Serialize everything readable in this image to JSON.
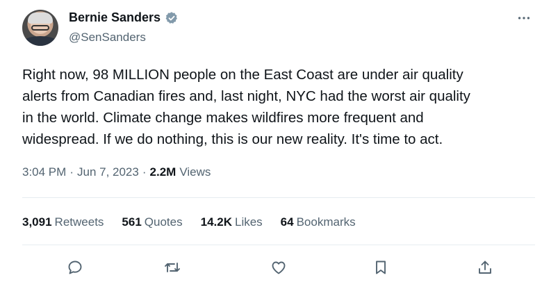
{
  "author": {
    "display_name": "Bernie Sanders",
    "handle": "@SenSanders",
    "verified_color": "#829aab"
  },
  "tweet": {
    "text": "Right now, 98 MILLION people on the East Coast are under air quality\nalerts from Canadian fires and, last night, NYC had the worst air quality\nin the world. Climate change makes wildfires more frequent and\nwidespread. If we do nothing, this is our new reality. It's time to act.",
    "time": "3:04 PM",
    "date": "Jun 7, 2023",
    "views_count": "2.2M",
    "views_label": "Views",
    "separator": "·"
  },
  "stats": {
    "retweets": {
      "count": "3,091",
      "label": "Retweets"
    },
    "quotes": {
      "count": "561",
      "label": "Quotes"
    },
    "likes": {
      "count": "14.2K",
      "label": "Likes"
    },
    "bookmarks": {
      "count": "64",
      "label": "Bookmarks"
    }
  },
  "actions": [
    "reply-icon",
    "retweet-icon",
    "like-icon",
    "bookmark-icon",
    "share-icon"
  ],
  "colors": {
    "text": "#0f1419",
    "secondary": "#536471",
    "divider": "#e6ecf0"
  }
}
